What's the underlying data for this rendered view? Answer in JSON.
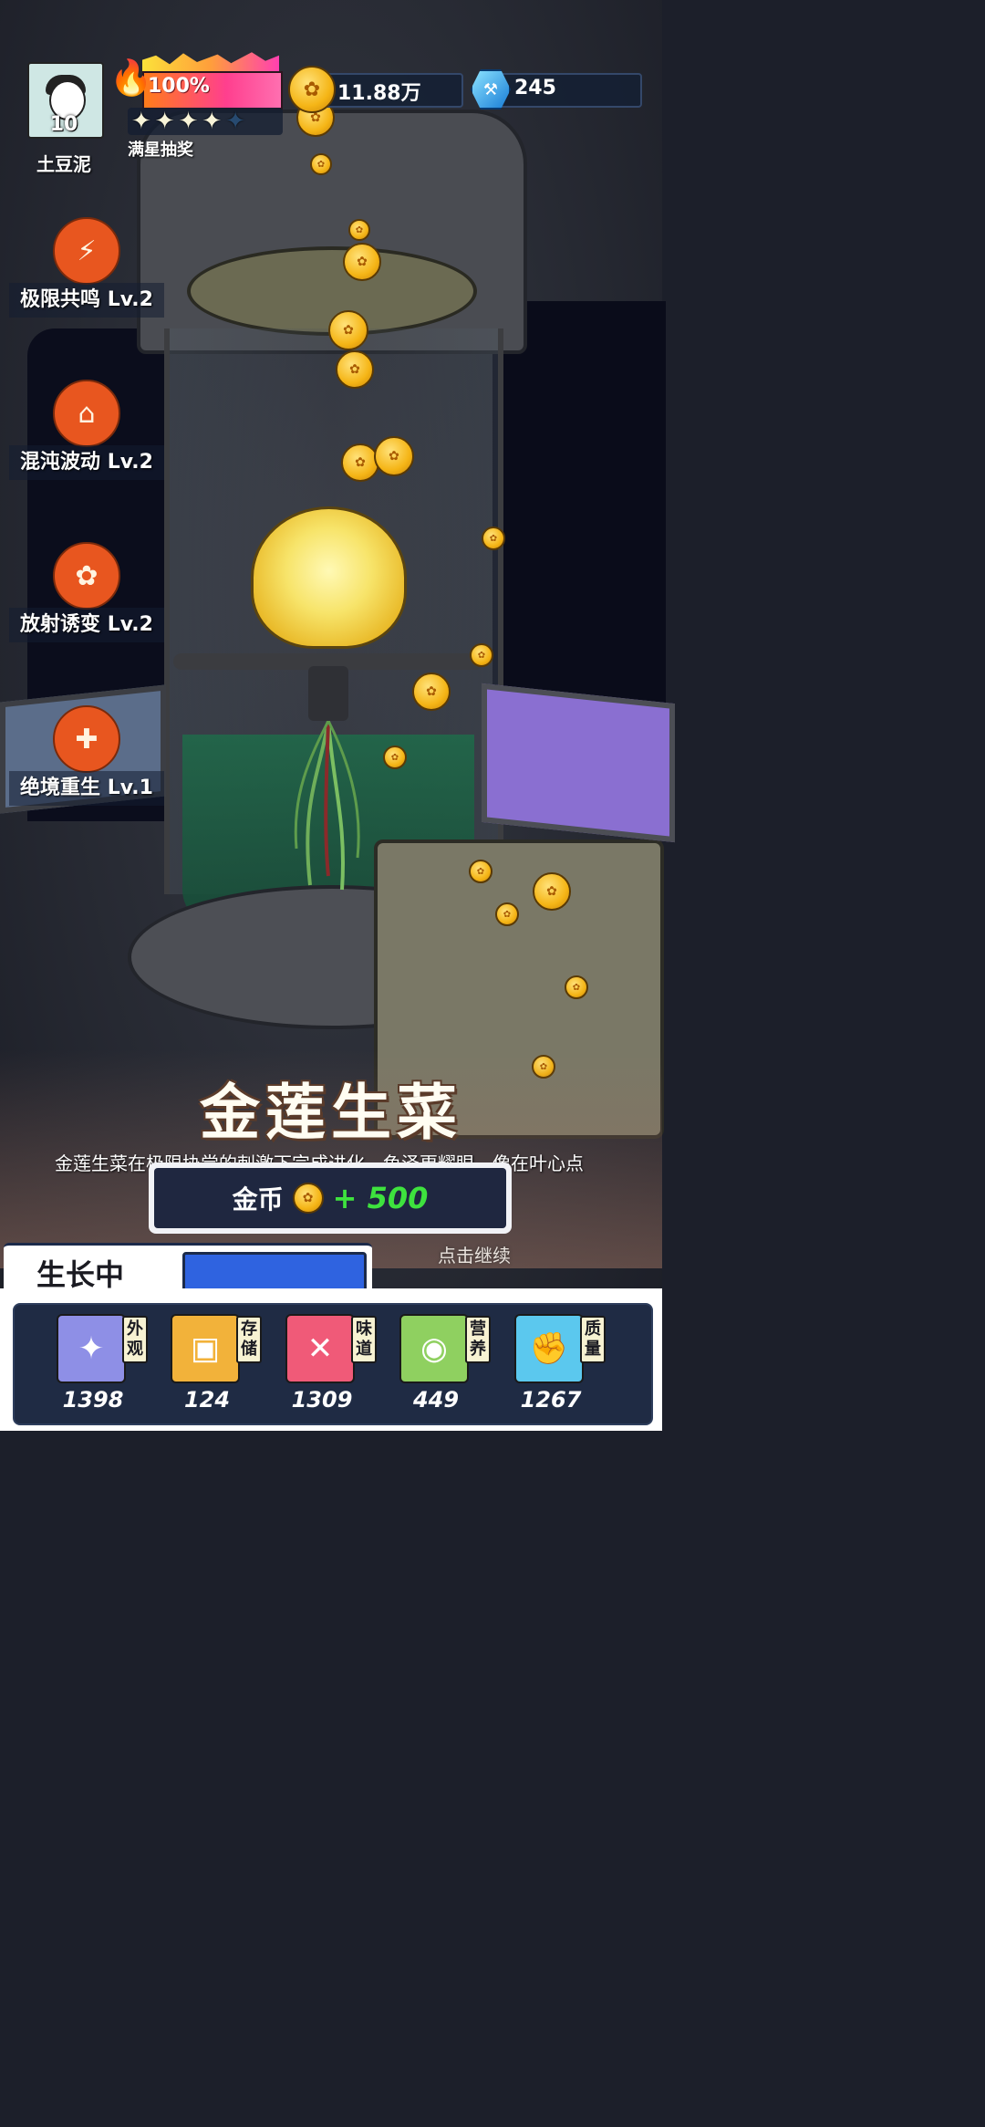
{
  "player": {
    "name": "土豆泥",
    "level": "10"
  },
  "energy": {
    "percent_text": "100%",
    "value": 1.0
  },
  "stars": {
    "filled": 4,
    "total": 5,
    "label": "满星抽奖"
  },
  "currency": {
    "gold": "11.88万",
    "gems": "245"
  },
  "skills": [
    {
      "label": "极限共鸣 Lv.2",
      "icon": "lightning-plant-icon",
      "glyph": "⚡"
    },
    {
      "label": "混沌波动 Lv.2",
      "icon": "terrarium-icon",
      "glyph": "⌂"
    },
    {
      "label": "放射诱变 Lv.2",
      "icon": "sprout-box-icon",
      "glyph": "✿"
    },
    {
      "label": "绝境重生 Lv.1",
      "icon": "syringe-leaf-icon",
      "glyph": "✚"
    }
  ],
  "plant": {
    "name": "金莲生菜",
    "description": "金莲生菜在极限协尝的刺激下完成进化，色泽更耀眼，像在叶心点"
  },
  "reward": {
    "label": "金币",
    "amount": "+ 500"
  },
  "continue_hint": "点击继续",
  "growth": {
    "label": "生长中"
  },
  "attributes": [
    {
      "tag": "外观",
      "value": "1398",
      "icon": "sparkle-icon",
      "glyph": "✦",
      "color": "#8e8fe6"
    },
    {
      "tag": "存储",
      "value": "124",
      "icon": "storage-box-icon",
      "glyph": "▣",
      "color": "#f2b23a"
    },
    {
      "tag": "味道",
      "value": "1309",
      "icon": "fork-knife-icon",
      "glyph": "✕",
      "color": "#f05a78"
    },
    {
      "tag": "营养",
      "value": "449",
      "icon": "citrus-icon",
      "glyph": "◉",
      "color": "#8fd060"
    },
    {
      "tag": "质量",
      "value": "1267",
      "icon": "muscle-arm-icon",
      "glyph": "✊",
      "color": "#5bc8ee"
    }
  ],
  "colors": {
    "accent_green": "#3ee23e",
    "growth_bar": "#2f63e0",
    "skill_orange": "#e8561f"
  }
}
